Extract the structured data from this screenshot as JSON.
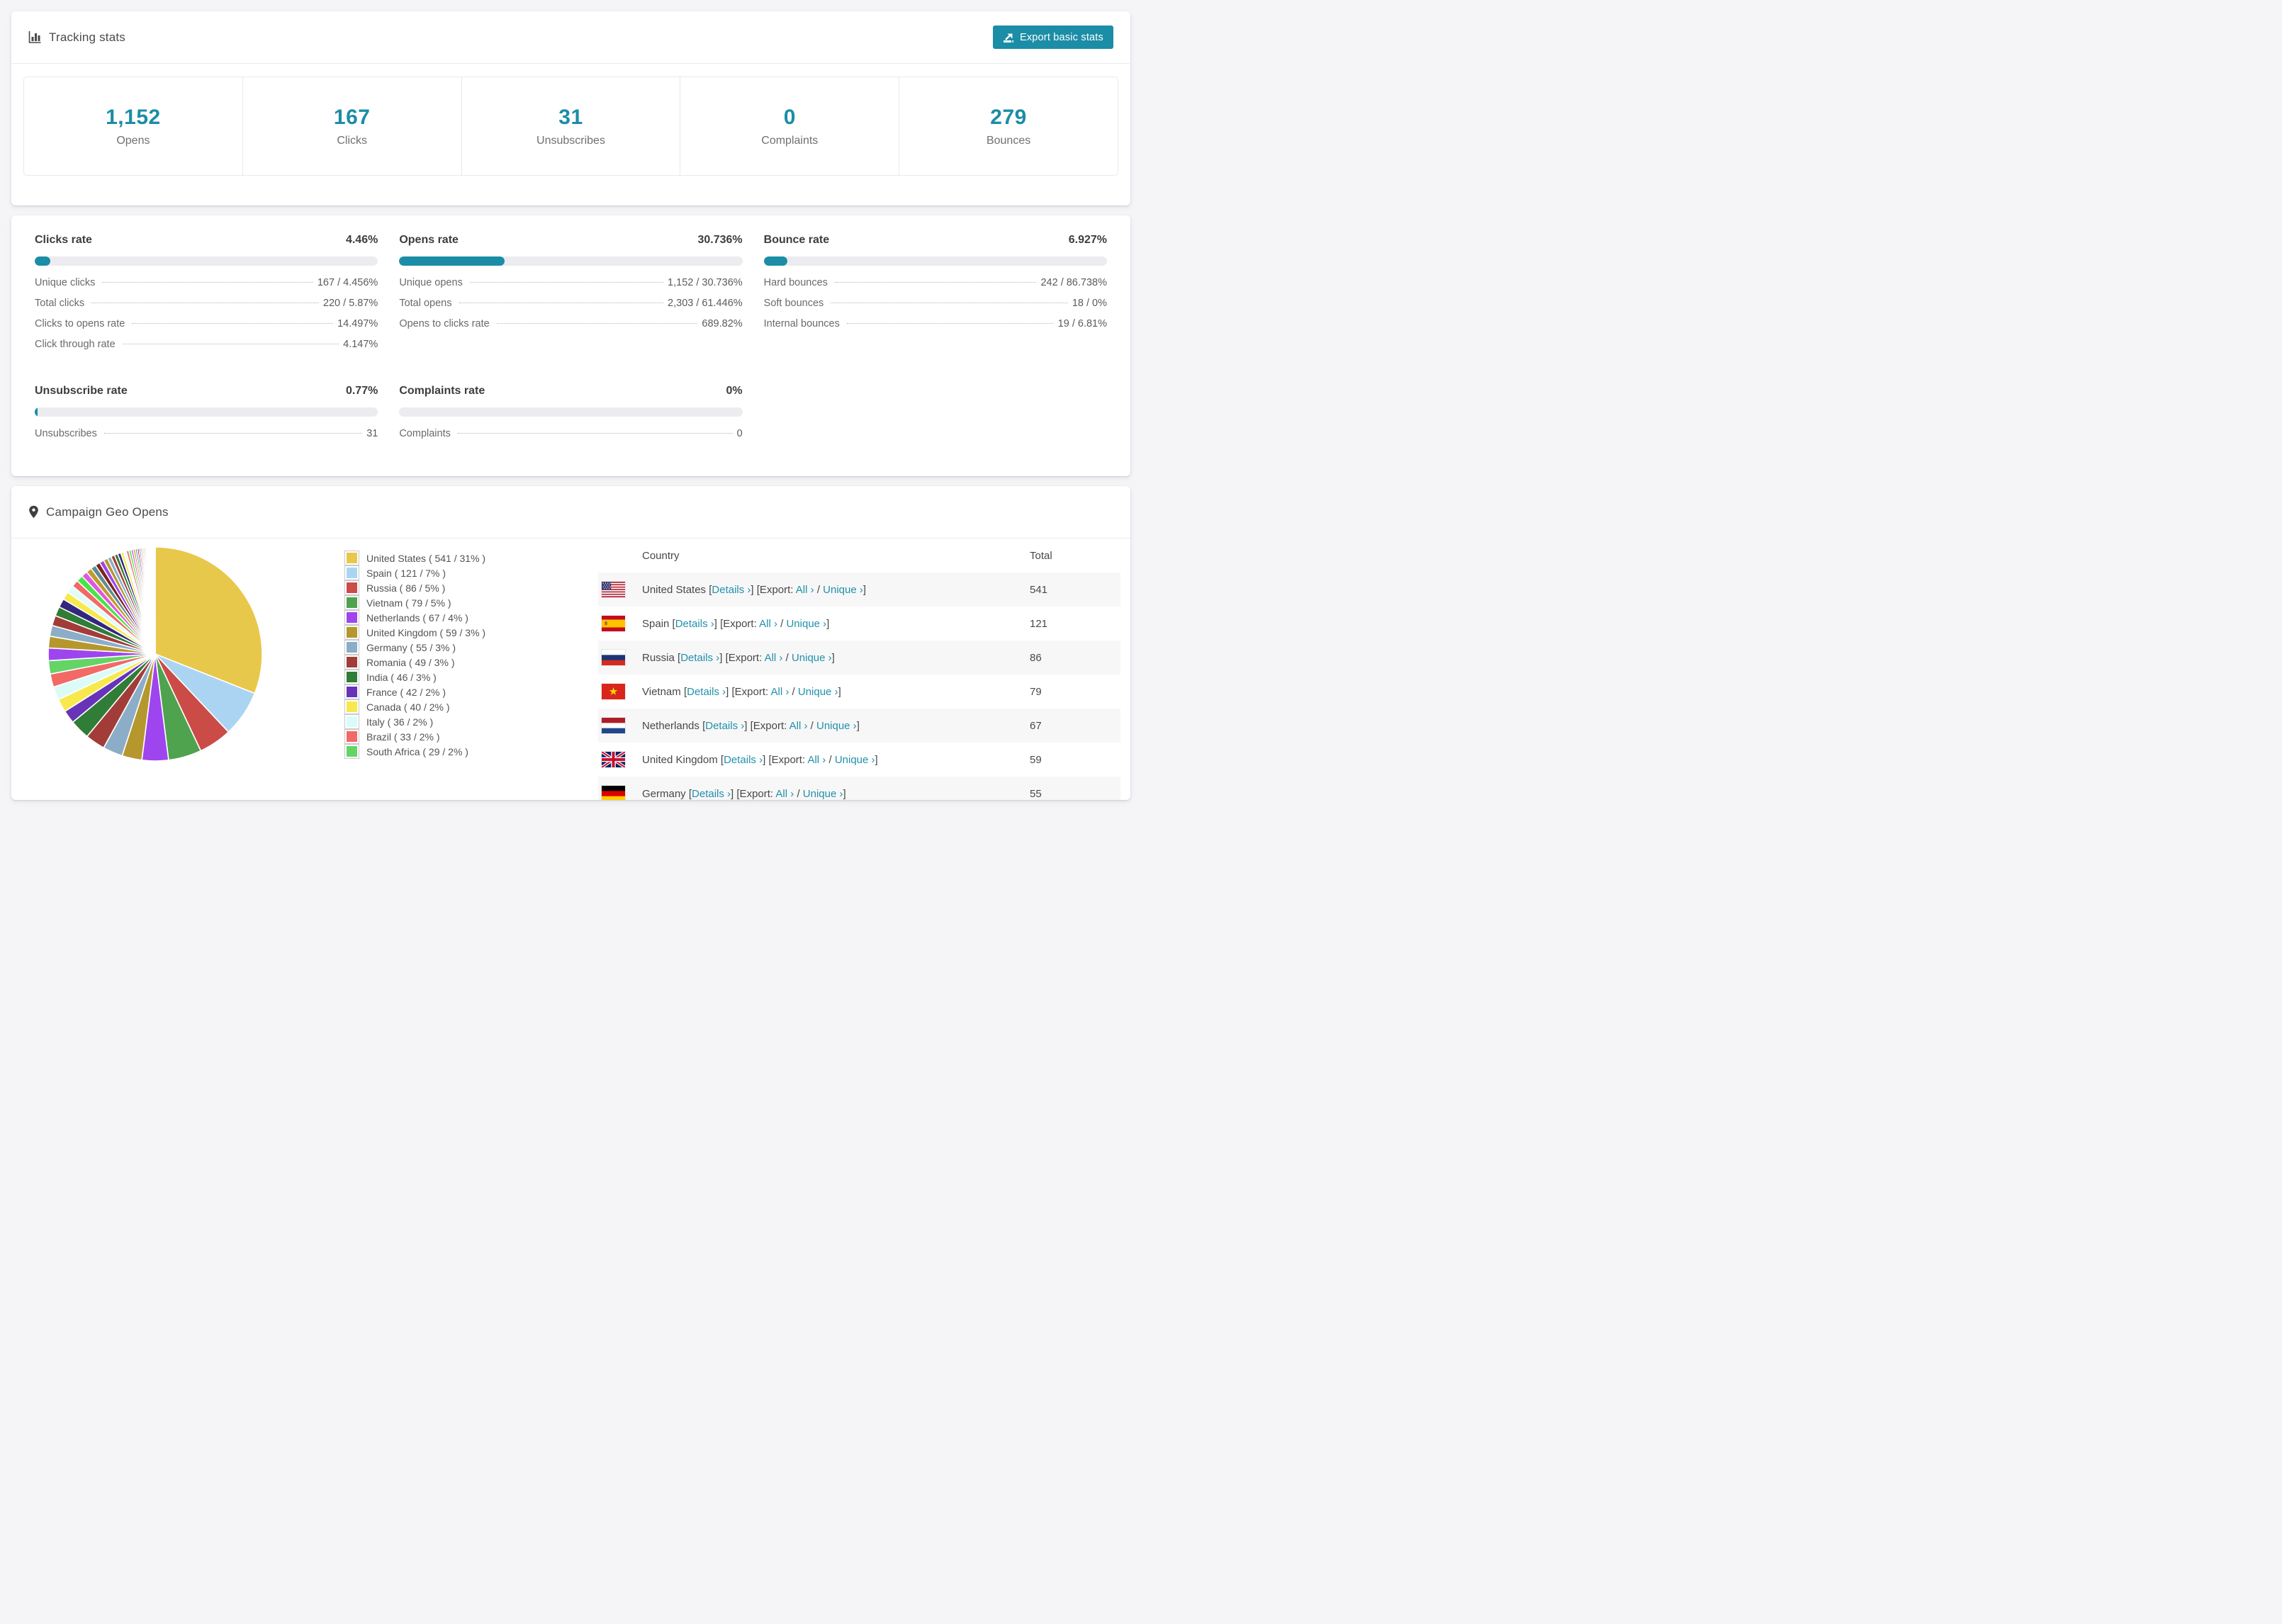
{
  "accent": "#1b8da6",
  "tracking": {
    "title": "Tracking stats",
    "export_label": "Export basic stats",
    "stats": [
      {
        "value": "1,152",
        "label": "Opens"
      },
      {
        "value": "167",
        "label": "Clicks"
      },
      {
        "value": "31",
        "label": "Unsubscribes"
      },
      {
        "value": "0",
        "label": "Complaints"
      },
      {
        "value": "279",
        "label": "Bounces"
      }
    ]
  },
  "rates": [
    {
      "title": "Clicks rate",
      "value": "4.46%",
      "percent": 4.46,
      "rows": [
        {
          "label": "Unique clicks",
          "value": "167 / 4.456%"
        },
        {
          "label": "Total clicks",
          "value": "220 / 5.87%"
        },
        {
          "label": "Clicks to opens rate",
          "value": "14.497%"
        },
        {
          "label": "Click through rate",
          "value": "4.147%"
        }
      ]
    },
    {
      "title": "Opens rate",
      "value": "30.736%",
      "percent": 30.736,
      "rows": [
        {
          "label": "Unique opens",
          "value": "1,152 / 30.736%"
        },
        {
          "label": "Total opens",
          "value": "2,303 / 61.446%"
        },
        {
          "label": "Opens to clicks rate",
          "value": "689.82%"
        }
      ]
    },
    {
      "title": "Bounce rate",
      "value": "6.927%",
      "percent": 6.927,
      "rows": [
        {
          "label": "Hard bounces",
          "value": "242 / 86.738%"
        },
        {
          "label": "Soft bounces",
          "value": "18 / 0%"
        },
        {
          "label": "Internal bounces",
          "value": "19 / 6.81%"
        }
      ]
    },
    {
      "title": "Unsubscribe rate",
      "value": "0.77%",
      "percent": 0.77,
      "rows": [
        {
          "label": "Unsubscribes",
          "value": "31"
        }
      ]
    },
    {
      "title": "Complaints rate",
      "value": "0%",
      "percent": 0,
      "rows": [
        {
          "label": "Complaints",
          "value": "0"
        }
      ]
    }
  ],
  "geo": {
    "title": "Campaign Geo Opens",
    "table": {
      "col_country": "Country",
      "col_total": "Total",
      "bracket_open": "[",
      "bracket_close": "]",
      "details_label": "Details ›",
      "export_open": "[Export:",
      "all_label": "All ›",
      "slash": "/",
      "unique_label": "Unique ›",
      "rows": [
        {
          "flag": "us",
          "country": "United States",
          "total": "541"
        },
        {
          "flag": "es",
          "country": "Spain",
          "total": "121"
        },
        {
          "flag": "ru",
          "country": "Russia",
          "total": "86"
        },
        {
          "flag": "vn",
          "country": "Vietnam",
          "total": "79"
        },
        {
          "flag": "nl",
          "country": "Netherlands",
          "total": "67"
        },
        {
          "flag": "gb",
          "country": "United Kingdom",
          "total": "59"
        },
        {
          "flag": "de",
          "country": "Germany",
          "total": "55"
        }
      ]
    },
    "chart_data": {
      "type": "pie",
      "title": "Campaign Geo Opens",
      "legend_position": "right",
      "legend_format": "label ( count / percent% )",
      "start_angle_deg": -90,
      "direction": "clockwise",
      "slices": [
        {
          "label": "United States",
          "count": 541,
          "percent": 31,
          "color": "#e8c84a"
        },
        {
          "label": "Spain",
          "count": 121,
          "percent": 7,
          "color": "#abd4f2"
        },
        {
          "label": "Russia",
          "count": 86,
          "percent": 5,
          "color": "#cb4b47"
        },
        {
          "label": "Vietnam",
          "count": 79,
          "percent": 5,
          "color": "#4fa34f"
        },
        {
          "label": "Netherlands",
          "count": 67,
          "percent": 4,
          "color": "#9f45ef"
        },
        {
          "label": "United Kingdom",
          "count": 59,
          "percent": 3,
          "color": "#b5972d"
        },
        {
          "label": "Germany",
          "count": 55,
          "percent": 3,
          "color": "#8badc8"
        },
        {
          "label": "Romania",
          "count": 49,
          "percent": 3,
          "color": "#a23c38"
        },
        {
          "label": "India",
          "count": 46,
          "percent": 3,
          "color": "#2f7d36"
        },
        {
          "label": "France",
          "count": 42,
          "percent": 2,
          "color": "#6733b8"
        },
        {
          "label": "Canada",
          "count": 40,
          "percent": 2,
          "color": "#f7e94d"
        },
        {
          "label": "Italy",
          "count": 36,
          "percent": 2,
          "color": "#dbfbf9"
        },
        {
          "label": "Brazil",
          "count": 33,
          "percent": 2,
          "color": "#f16a66"
        },
        {
          "label": "South Africa",
          "count": 29,
          "percent": 2,
          "color": "#64d466"
        }
      ],
      "other_slices": {
        "note": "many small unlabeled country slices complete the circle",
        "total_percent": 26,
        "count": 44,
        "decay": 0.93,
        "palette": [
          "#9f45ef",
          "#b5972d",
          "#8badc8",
          "#a23c38",
          "#2f7d36",
          "#33267e",
          "#f7e94d",
          "#e3fbf9",
          "#f16a66",
          "#47e547",
          "#e057e0",
          "#c29a2c",
          "#5f8d96",
          "#7c2320"
        ]
      }
    }
  }
}
